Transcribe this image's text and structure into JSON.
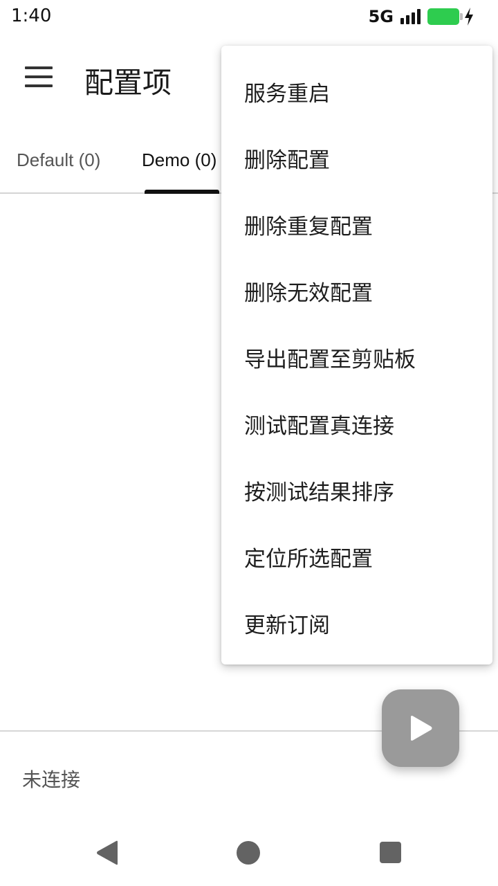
{
  "status_bar": {
    "time": "1:40",
    "network": "5G",
    "icons": [
      "signal-icon",
      "battery-charging-icon"
    ],
    "battery_color": "#2ecc4f"
  },
  "app_bar": {
    "title": "配置项",
    "menu_icon": "hamburger-menu-icon"
  },
  "tabs": [
    {
      "label": "Default (0)",
      "selected": false
    },
    {
      "label": "Demo (0)",
      "selected": true
    }
  ],
  "overflow_menu": {
    "items": [
      {
        "label": "服务重启"
      },
      {
        "label": "删除配置"
      },
      {
        "label": "删除重复配置"
      },
      {
        "label": "删除无效配置"
      },
      {
        "label": "导出配置至剪贴板"
      },
      {
        "label": "测试配置真连接"
      },
      {
        "label": "按测试结果排序"
      },
      {
        "label": "定位所选配置"
      },
      {
        "label": "更新订阅"
      }
    ]
  },
  "connection": {
    "status": "未连接"
  },
  "fab": {
    "icon": "play-icon",
    "color": "#9a9a9a"
  },
  "nav_bar": {
    "icons": [
      "back-icon",
      "home-icon",
      "recents-icon"
    ]
  }
}
